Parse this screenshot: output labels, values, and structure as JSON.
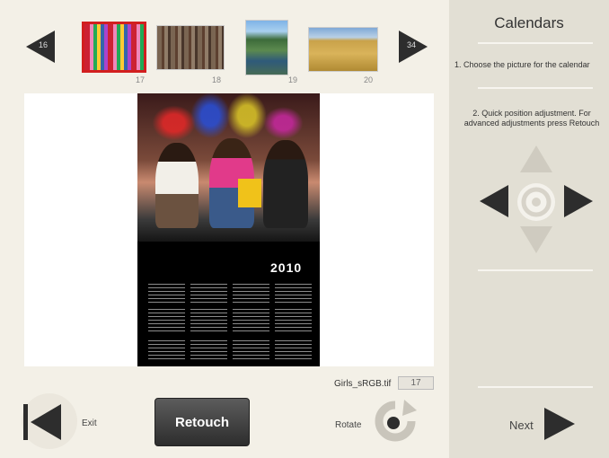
{
  "toolbar": {
    "prev_page_number": "16",
    "next_page_number": "34"
  },
  "thumbnails": [
    {
      "index": "17",
      "name": "Girls_sRGB.tif",
      "selected": true
    },
    {
      "index": "18",
      "selected": false
    },
    {
      "index": "19",
      "selected": false
    },
    {
      "index": "20",
      "selected": false
    }
  ],
  "calendar": {
    "year": "2010"
  },
  "photo_info": {
    "file_name": "Girls_sRGB.tif",
    "index": "17"
  },
  "actions": {
    "exit_label": "Exit",
    "retouch_label": "Retouch",
    "rotate_label": "Rotate",
    "next_label": "Next"
  },
  "panel": {
    "title": "Calendars",
    "step1": "1. Choose the picture for the calendar",
    "step2_line1": "2. Quick position adjustment. For",
    "step2_line2": "advanced adjustments press Retouch"
  },
  "colors": {
    "selection_border": "#d21f1f",
    "arrow_dark": "#2d2d2d",
    "arrow_disabled": "#cfcbc0",
    "panel_bg": "#e2dfd4"
  },
  "icons": {
    "prev": "chevron-left-icon",
    "next": "chevron-right-icon",
    "exit": "skip-back-icon",
    "rotate": "rotate-icon",
    "dpad_up": "arrow-up-icon",
    "dpad_down": "arrow-down-icon",
    "dpad_left": "arrow-left-icon",
    "dpad_right": "arrow-right-icon",
    "dpad_center": "target-icon"
  }
}
